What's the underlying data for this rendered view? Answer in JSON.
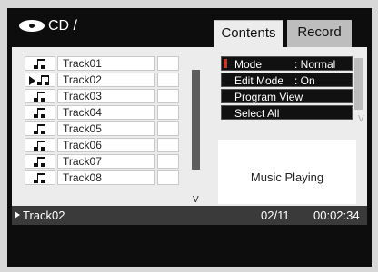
{
  "header": {
    "path": "CD /"
  },
  "tabs": [
    {
      "label": "Contents",
      "active": true
    },
    {
      "label": "Record",
      "active": false
    }
  ],
  "tracks": [
    {
      "name": "Track01",
      "playing": false
    },
    {
      "name": "Track02",
      "playing": true
    },
    {
      "name": "Track03",
      "playing": false
    },
    {
      "name": "Track04",
      "playing": false
    },
    {
      "name": "Track05",
      "playing": false
    },
    {
      "name": "Track06",
      "playing": false
    },
    {
      "name": "Track07",
      "playing": false
    },
    {
      "name": "Track08",
      "playing": false
    }
  ],
  "track_scroll_marker": "V",
  "menu": [
    {
      "label": "Mode",
      "value": ": Normal",
      "selected": true
    },
    {
      "label": "Edit Mode",
      "value": ": On",
      "selected": false
    },
    {
      "label": "Program View",
      "value": "",
      "selected": false
    },
    {
      "label": "Select All",
      "value": "",
      "selected": false
    }
  ],
  "menu_scroll_marker": "V",
  "status": "Music Playing",
  "now_playing": {
    "track": "Track02",
    "count": "02/11",
    "time": "00:02:34"
  },
  "colors": {
    "background": "#0d0d0d",
    "panel": "#ececec",
    "menu_bg": "#111111",
    "status_bar": "#3a3a3a"
  },
  "icons": {
    "disc": "disc-icon",
    "note": "music-note-icon",
    "play": "play-marker-icon"
  }
}
